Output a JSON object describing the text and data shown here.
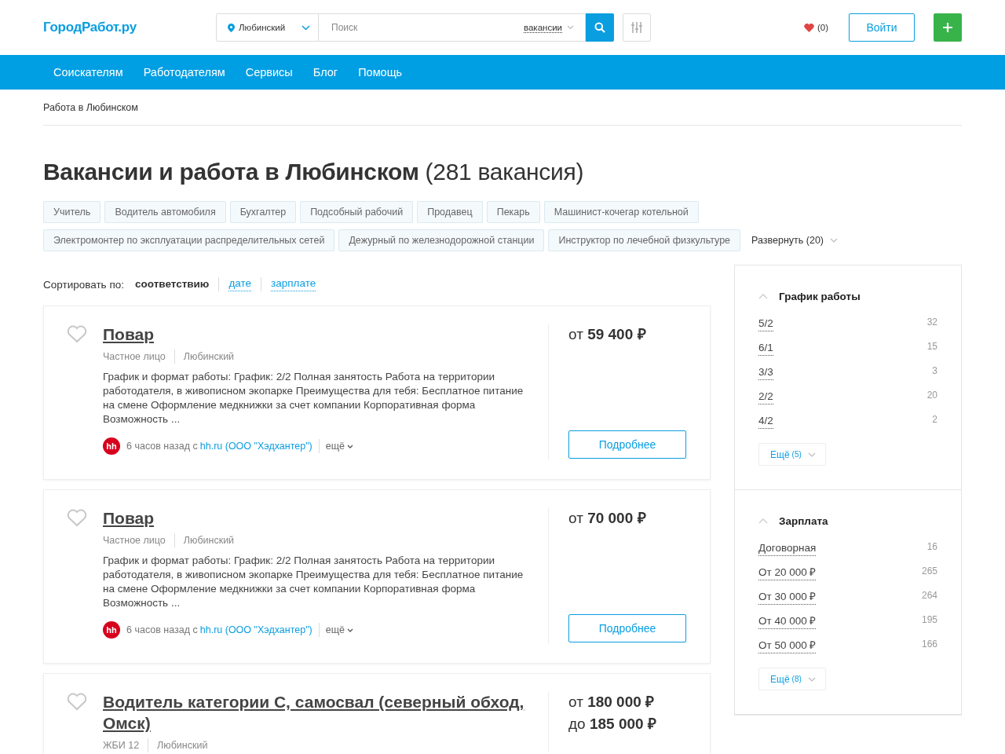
{
  "header": {
    "logo": "ГородРабот.ру",
    "location": "Любинский",
    "search_placeholder": "Поиск",
    "search_type": "вакансии",
    "favorites_count": "(0)",
    "login": "Войти"
  },
  "nav": [
    "Соискателям",
    "Работодателям",
    "Сервисы",
    "Блог",
    "Помощь"
  ],
  "breadcrumb": "Работа в Любинском",
  "heading": {
    "title": "Вакансии и работа в Любинском",
    "count": "(281 вакансия)"
  },
  "tags": [
    "Учитель",
    "Водитель автомобиля",
    "Бухгалтер",
    "Подсобный рабочий",
    "Продавец",
    "Пекарь",
    "Машинист-кочегар котельной",
    "Электромонтер по эксплуатации распределительных сетей",
    "Дежурный по железнодорожной станции",
    "Инструктор по лечебной физкультуре"
  ],
  "tags_expand": "Развернуть (20)",
  "sort": {
    "label": "Сортировать по:",
    "options": [
      {
        "label": "соответствию",
        "selected": true
      },
      {
        "label": "дате",
        "selected": false
      },
      {
        "label": "зарплате",
        "selected": false
      }
    ]
  },
  "vacancies": [
    {
      "title": "Повар",
      "employer": "Частное лицо",
      "location": "Любинский",
      "description": "График и формат работы: График: 2/2 Полная занятость Работа на территории работодателя, в живописном экопарке Преимущества для тебя: Бесплатное питание на смене Оформление медкнижки за счет компании Корпоративная форма Возможность ...",
      "source_badge": "hh",
      "source_time": "6 часов назад с",
      "source_link": "hh.ru (ООО \"Хэдхантер\")",
      "more": "ещё",
      "salary": [
        {
          "prefix": "от",
          "amount": "59 400 ₽"
        }
      ],
      "details_button": "Подробнее"
    },
    {
      "title": "Повар",
      "employer": "Частное лицо",
      "location": "Любинский",
      "description": "График и формат работы: График: 2/2 Полная занятость Работа на территории работодателя, в живописном экопарке Преимущества для тебя: Бесплатное питание на смене Оформление медкнижки за счет компании Корпоративная форма Возможность ...",
      "source_badge": "hh",
      "source_time": "6 часов назад с",
      "source_link": "hh.ru (ООО \"Хэдхантер\")",
      "more": "ещё",
      "salary": [
        {
          "prefix": "от",
          "amount": "70 000 ₽"
        }
      ],
      "details_button": "Подробнее"
    },
    {
      "title": "Водитель категории С, самосвал (северный обход, Омск)",
      "employer": "ЖБИ 12",
      "location": "Любинский",
      "salary": [
        {
          "prefix": "от",
          "amount": "180 000 ₽"
        },
        {
          "prefix": "до",
          "amount": "185 000 ₽"
        }
      ]
    }
  ],
  "filters": [
    {
      "title": "График работы",
      "expanded": true,
      "options": [
        {
          "label": "5/2",
          "count": "32"
        },
        {
          "label": "6/1",
          "count": "15"
        },
        {
          "label": "3/3",
          "count": "3"
        },
        {
          "label": "2/2",
          "count": "20"
        },
        {
          "label": "4/2",
          "count": "2"
        }
      ],
      "more_label": "Ещё",
      "more_count": "(5)"
    },
    {
      "title": "Зарплата",
      "expanded": true,
      "options": [
        {
          "label": "Договорная",
          "count": "16"
        },
        {
          "label": "От 20 000 ₽",
          "count": "265"
        },
        {
          "label": "От 30 000 ₽",
          "count": "264"
        },
        {
          "label": "От 40 000 ₽",
          "count": "195"
        },
        {
          "label": "От 50 000 ₽",
          "count": "166"
        }
      ],
      "more_label": "Ещё",
      "more_count": "(8)"
    }
  ]
}
